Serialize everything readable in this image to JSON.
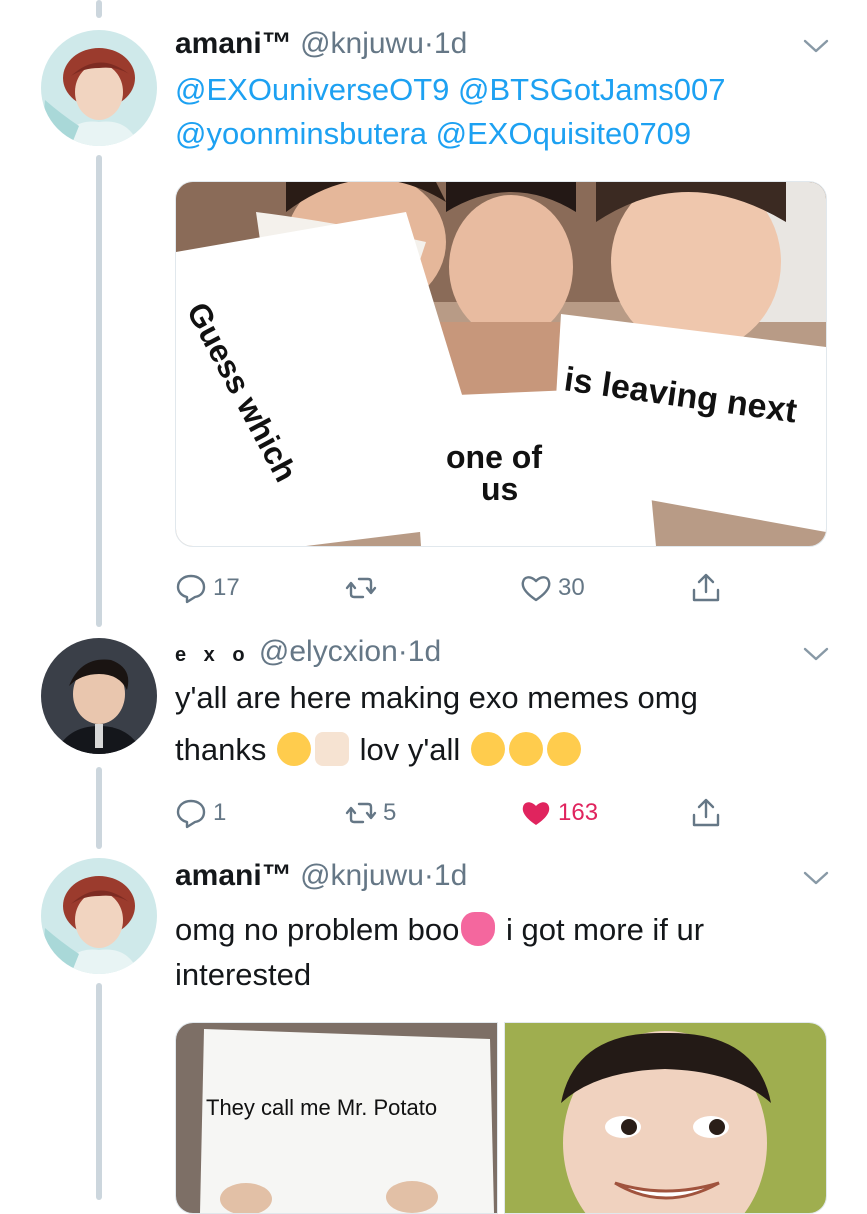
{
  "colors": {
    "link": "#1da1f2",
    "secondary": "#657786",
    "like_active": "#e0245e",
    "thread_line": "#ccd6dd"
  },
  "tweets": [
    {
      "name": "amani™",
      "handle": "@knjuwu",
      "dot": "·",
      "time": "1d",
      "mentions_line1": "@EXOuniverseOT9 @BTSGotJams007",
      "mentions_line2": "@yoonminsbutera @EXOquisite0709",
      "meme": {
        "sign1": "Guess which",
        "sign2_line1": "one of",
        "sign2_line2": "us",
        "sign3": "is leaving next"
      },
      "actions": {
        "replies": "17",
        "retweets": "",
        "likes": "30"
      },
      "icons": [
        "reply-icon",
        "retweet-icon",
        "heart-icon",
        "share-icon",
        "chevron-down-icon"
      ]
    },
    {
      "name": "e x o",
      "handle": "@elycxion",
      "dot": "·",
      "time": "1d",
      "text_line1": "y'all are here making exo memes omg",
      "text_line2a": "thanks",
      "text_line2b": "lov y'all",
      "actions": {
        "replies": "1",
        "retweets": "5",
        "likes": "163"
      },
      "icons": [
        "reply-icon",
        "retweet-icon",
        "heart-filled-icon",
        "share-icon",
        "chevron-down-icon"
      ]
    },
    {
      "name": "amani™",
      "handle": "@knjuwu",
      "dot": "·",
      "time": "1d",
      "text_line1a": "omg no problem boo",
      "text_line1b": "i got more if ur",
      "text_line2": "interested",
      "meme_sign": "They call me Mr. Potato",
      "icons": [
        "chevron-down-icon"
      ]
    }
  ]
}
